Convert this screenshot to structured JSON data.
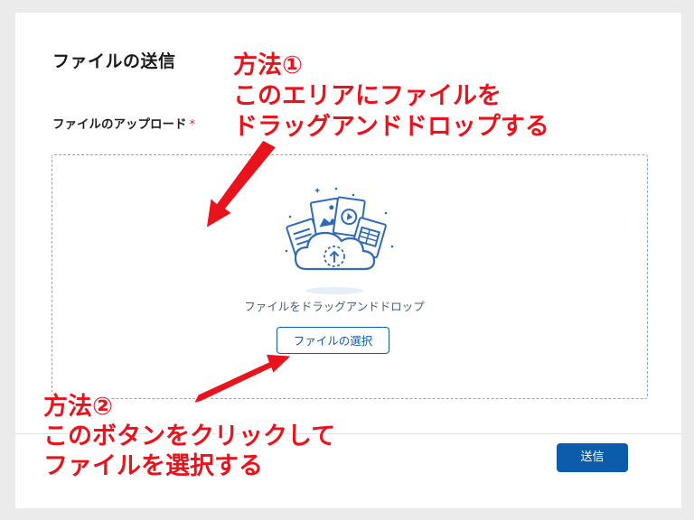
{
  "dialog": {
    "title": "ファイルの送信",
    "upload_label": "ファイルのアップロード",
    "required_mark": "*",
    "dropzone": {
      "text": "ファイルをドラッグアンドドロップ",
      "select_button": "ファイルの選択",
      "illustration_icon": "cloud-upload-documents-icon"
    },
    "footer": {
      "send_button": "送信"
    }
  },
  "annotations": {
    "method1": {
      "lines": [
        "方法①",
        "このエリアにファイルを",
        "ドラッグアンドドロップする"
      ]
    },
    "method2": {
      "lines": [
        "方法②",
        "このボタンをクリックして",
        "ファイルを選択する"
      ]
    },
    "color": "#e8131c"
  },
  "colors": {
    "brand": "#0b5cab",
    "dropzone_border": "#7aa9dd",
    "required": "#c23934"
  }
}
